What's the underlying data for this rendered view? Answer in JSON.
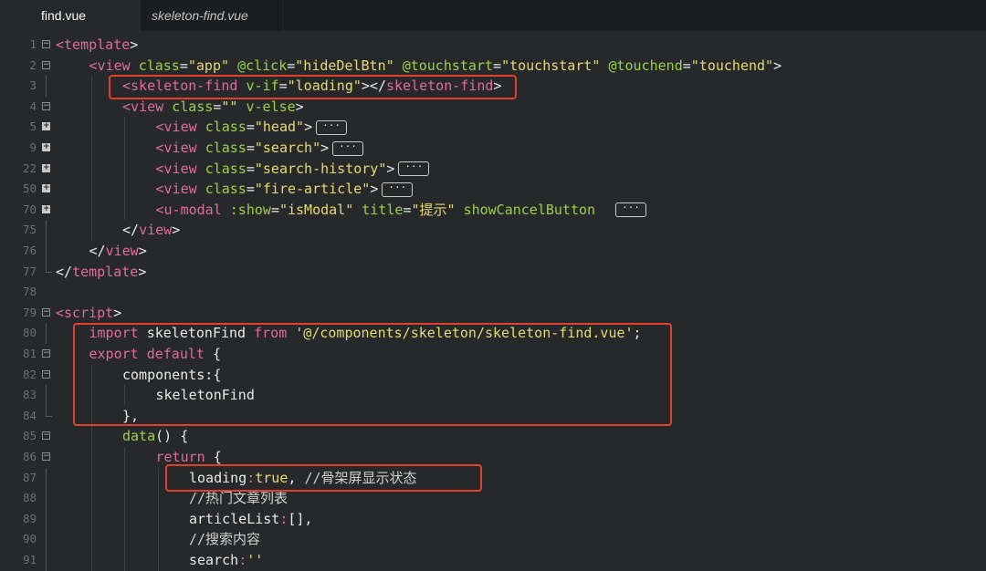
{
  "tabs": [
    {
      "label": "find.vue",
      "active": true
    },
    {
      "label": "skeleton-find.vue",
      "active": false
    }
  ],
  "colors": {
    "background": "#26282a",
    "tag": "#e06c9f",
    "attribute": "#9bd14a",
    "string": "#e6db74",
    "highlight_box": "#e0412d"
  },
  "lines": [
    {
      "n": "1",
      "fold": "minus",
      "indent": 0,
      "parts": [
        [
          "tag",
          "<template"
        ],
        [
          "txt",
          ">"
        ]
      ]
    },
    {
      "n": "2",
      "fold": "minus",
      "indent": 1,
      "parts": [
        [
          "tag",
          "<view "
        ],
        [
          "attr",
          "class"
        ],
        [
          "txt",
          "="
        ],
        [
          "str",
          "\"app\""
        ],
        [
          "txt",
          " "
        ],
        [
          "attr",
          "@click"
        ],
        [
          "txt",
          "="
        ],
        [
          "str",
          "\"hideDelBtn\""
        ],
        [
          "txt",
          " "
        ],
        [
          "attr",
          "@touchstart"
        ],
        [
          "txt",
          "="
        ],
        [
          "str",
          "\"touchstart\""
        ],
        [
          "txt",
          " "
        ],
        [
          "attr",
          "@touchend"
        ],
        [
          "txt",
          "="
        ],
        [
          "str",
          "\"touchend\""
        ],
        [
          "txt",
          ">"
        ]
      ]
    },
    {
      "n": "3",
      "fold": "line",
      "indent": 2,
      "parts": [
        [
          "tag",
          "<skeleton-find "
        ],
        [
          "attr",
          "v-if"
        ],
        [
          "txt",
          "="
        ],
        [
          "str",
          "\"loading\""
        ],
        [
          "txt",
          "></"
        ],
        [
          "tag",
          "skeleton-find"
        ],
        [
          "txt",
          ">"
        ]
      ]
    },
    {
      "n": "4",
      "fold": "minus",
      "indent": 2,
      "parts": [
        [
          "tag",
          "<view "
        ],
        [
          "attr",
          "class"
        ],
        [
          "txt",
          "="
        ],
        [
          "str",
          "\"\""
        ],
        [
          "txt",
          " "
        ],
        [
          "attr",
          "v-else"
        ],
        [
          "txt",
          ">"
        ]
      ]
    },
    {
      "n": "5",
      "fold": "plus",
      "indent": 3,
      "parts": [
        [
          "tag",
          "<view "
        ],
        [
          "attr",
          "class"
        ],
        [
          "txt",
          "="
        ],
        [
          "str",
          "\"head\""
        ],
        [
          "txt",
          ">"
        ]
      ],
      "ellipsis": true
    },
    {
      "n": "9",
      "fold": "plus",
      "indent": 3,
      "parts": [
        [
          "tag",
          "<view "
        ],
        [
          "attr",
          "class"
        ],
        [
          "txt",
          "="
        ],
        [
          "str",
          "\"search\""
        ],
        [
          "txt",
          ">"
        ]
      ],
      "ellipsis": true
    },
    {
      "n": "22",
      "fold": "plus",
      "indent": 3,
      "parts": [
        [
          "tag",
          "<view "
        ],
        [
          "attr",
          "class"
        ],
        [
          "txt",
          "="
        ],
        [
          "str",
          "\"search-history\""
        ],
        [
          "txt",
          ">"
        ]
      ],
      "ellipsis": true
    },
    {
      "n": "50",
      "fold": "plus",
      "indent": 3,
      "parts": [
        [
          "tag",
          "<view "
        ],
        [
          "attr",
          "class"
        ],
        [
          "txt",
          "="
        ],
        [
          "str",
          "\"fire-article\""
        ],
        [
          "txt",
          ">"
        ]
      ],
      "ellipsis": true
    },
    {
      "n": "70",
      "fold": "plus",
      "indent": 3,
      "parts": [
        [
          "tag",
          "<u-modal "
        ],
        [
          "attr",
          ":show"
        ],
        [
          "txt",
          "="
        ],
        [
          "str",
          "\"isModal\""
        ],
        [
          "txt",
          " "
        ],
        [
          "attr",
          "title"
        ],
        [
          "txt",
          "="
        ],
        [
          "str",
          "\"提示\""
        ],
        [
          "txt",
          " "
        ],
        [
          "attr",
          "showCancelButton"
        ],
        [
          "txt",
          "  "
        ]
      ],
      "ellipsis": true
    },
    {
      "n": "75",
      "fold": "line",
      "indent": 2,
      "parts": [
        [
          "txt",
          "</"
        ],
        [
          "tag",
          "view"
        ],
        [
          "txt",
          ">"
        ]
      ]
    },
    {
      "n": "76",
      "fold": "line",
      "indent": 1,
      "parts": [
        [
          "txt",
          "</"
        ],
        [
          "tag",
          "view"
        ],
        [
          "txt",
          ">"
        ]
      ]
    },
    {
      "n": "77",
      "fold": "end",
      "indent": 0,
      "parts": [
        [
          "txt",
          "</"
        ],
        [
          "tag",
          "template"
        ],
        [
          "txt",
          ">"
        ]
      ]
    },
    {
      "n": "78",
      "fold": "none",
      "indent": 0,
      "parts": []
    },
    {
      "n": "79",
      "fold": "minus",
      "indent": 0,
      "parts": [
        [
          "tag",
          "<script"
        ],
        [
          "txt",
          ">"
        ]
      ]
    },
    {
      "n": "80",
      "fold": "line",
      "indent": 1,
      "parts": [
        [
          "kw",
          "import "
        ],
        [
          "txt",
          "skeletonFind "
        ],
        [
          "kw",
          "from "
        ],
        [
          "str",
          "'@/components/skeleton/skeleton-find.vue'"
        ],
        [
          "txt",
          ";"
        ]
      ]
    },
    {
      "n": "81",
      "fold": "minus",
      "indent": 1,
      "parts": [
        [
          "kw",
          "export default "
        ],
        [
          "txt",
          "{"
        ]
      ]
    },
    {
      "n": "82",
      "fold": "minus",
      "indent": 2,
      "parts": [
        [
          "txt",
          "components:{"
        ]
      ]
    },
    {
      "n": "83",
      "fold": "line",
      "indent": 3,
      "parts": [
        [
          "txt",
          "skeletonFind"
        ]
      ]
    },
    {
      "n": "84",
      "fold": "end",
      "indent": 2,
      "parts": [
        [
          "txt",
          "},"
        ]
      ]
    },
    {
      "n": "85",
      "fold": "minus",
      "indent": 2,
      "parts": [
        [
          "attr",
          "data"
        ],
        [
          "txt",
          "() {"
        ]
      ]
    },
    {
      "n": "86",
      "fold": "minus",
      "indent": 3,
      "parts": [
        [
          "kw",
          "return "
        ],
        [
          "txt",
          "{"
        ]
      ]
    },
    {
      "n": "87",
      "fold": "line",
      "indent": 4,
      "parts": [
        [
          "txt",
          "loading"
        ],
        [
          "kw",
          ":"
        ],
        [
          "str",
          "true"
        ],
        [
          "txt",
          ", "
        ],
        [
          "cmt",
          "//骨架屏显示状态"
        ]
      ]
    },
    {
      "n": "88",
      "fold": "line",
      "indent": 4,
      "parts": [
        [
          "cmt",
          "//热门文章列表"
        ]
      ]
    },
    {
      "n": "89",
      "fold": "line",
      "indent": 4,
      "parts": [
        [
          "txt",
          "articleList"
        ],
        [
          "kw",
          ":"
        ],
        [
          "txt",
          "[],"
        ]
      ]
    },
    {
      "n": "90",
      "fold": "line",
      "indent": 4,
      "parts": [
        [
          "cmt",
          "//搜索内容"
        ]
      ]
    },
    {
      "n": "91",
      "fold": "line",
      "indent": 4,
      "parts": [
        [
          "txt",
          "search"
        ],
        [
          "kw",
          ":"
        ],
        [
          "str",
          "''"
        ]
      ]
    }
  ]
}
